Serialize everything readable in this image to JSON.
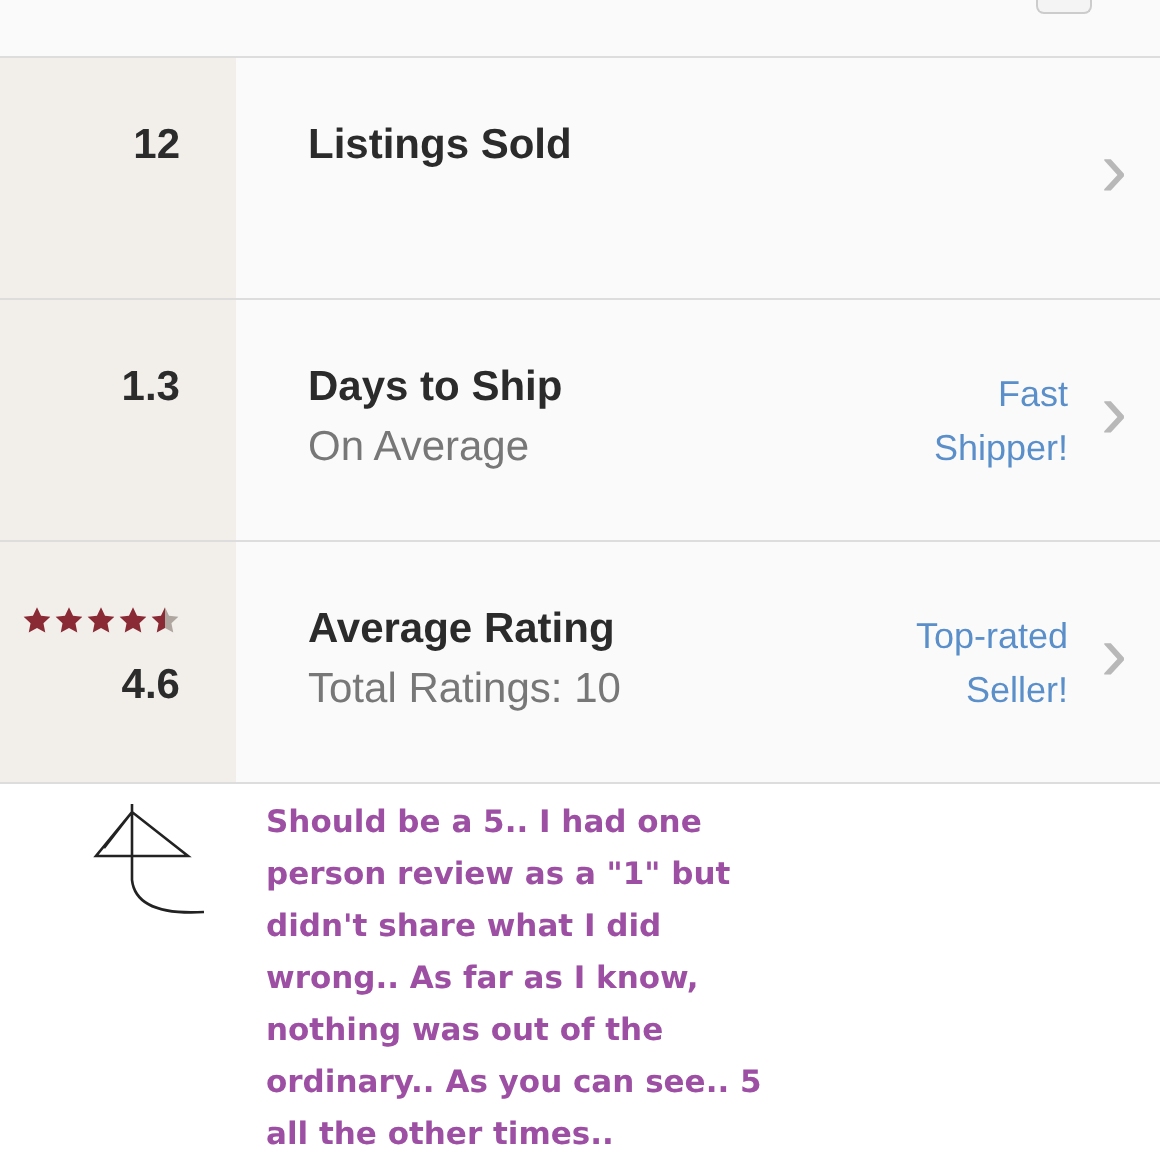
{
  "stats": [
    {
      "kind": "count",
      "value": "12",
      "title": "Listings Sold",
      "chevron": "›"
    },
    {
      "kind": "count",
      "value": "1.3",
      "title": "Days to Ship",
      "subtitle": "On Average",
      "badge": [
        "Fast",
        "Shipper!"
      ],
      "chevron": "›"
    },
    {
      "kind": "rating",
      "stars": 4.5,
      "value": "4.6",
      "title": "Average Rating",
      "subtitle": "Total Ratings: 10",
      "badge": [
        "Top-rated",
        "Seller!"
      ],
      "chevron": "›"
    }
  ],
  "note": {
    "lines": [
      "Should be a 5.. I had one",
      "person review as a \"1\" but",
      "didn't share what I did",
      "wrong.. As far as I know,",
      "nothing was out of the",
      "ordinary.. As you can see.. 5",
      "all the other times.."
    ]
  }
}
